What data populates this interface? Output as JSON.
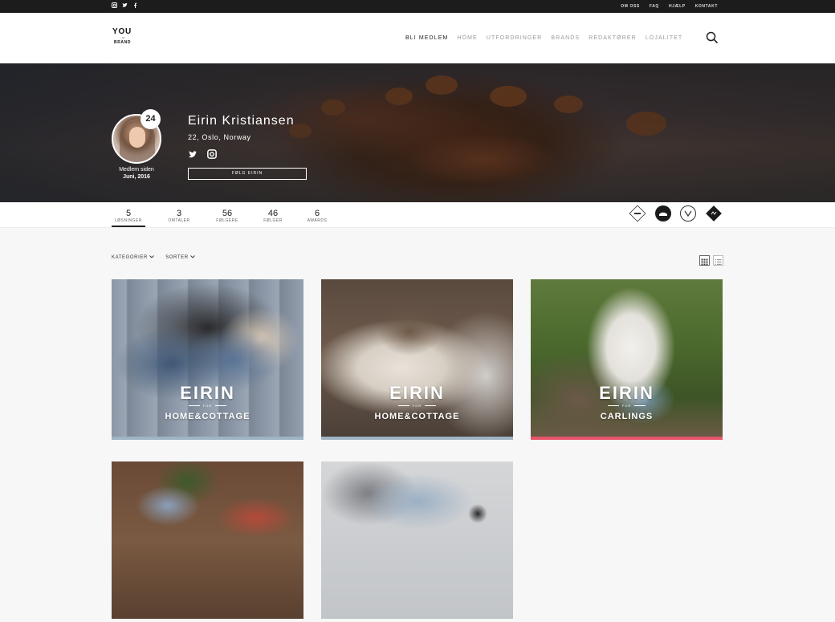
{
  "topbar": {
    "social_icons": [
      "instagram-icon",
      "twitter-icon",
      "facebook-icon"
    ],
    "links": [
      "OM OSS",
      "FAQ",
      "HJÆLP",
      "KONTAKT"
    ]
  },
  "header": {
    "logo": {
      "line1": "YOU",
      "line2": "for",
      "line3": "BRAND"
    },
    "nav": [
      "BLI MEDLEM",
      "HOME",
      "UTFORDRINGER",
      "BRANDS",
      "REDAKTØRER",
      "LOJALITET"
    ],
    "search_icon": "search-icon"
  },
  "profile": {
    "level": "24",
    "name": "Eirin Kristiansen",
    "location": "22, Oslo, Norway",
    "member_since_label": "Medlem siden",
    "member_since_date": "Juni, 2016",
    "social_icons": [
      "twitter-icon",
      "instagram-icon"
    ],
    "follow_label": "FØLG EIRIN"
  },
  "stats": [
    {
      "value": "5",
      "label": "LØSNINGER",
      "active": true
    },
    {
      "value": "3",
      "label": "OMTALER",
      "active": false
    },
    {
      "value": "56",
      "label": "FØLGERE",
      "active": false
    },
    {
      "value": "46",
      "label": "FØLGER",
      "active": false
    },
    {
      "value": "6",
      "label": "AWARDS",
      "active": false
    }
  ],
  "brand_badges": [
    "brand-badge-1",
    "brand-badge-2",
    "brand-badge-3",
    "brand-badge-4"
  ],
  "filters": {
    "category": "KATEGORIER",
    "sort": "SORTER"
  },
  "view_toggle": [
    "grid-view-icon",
    "list-view-icon"
  ],
  "cards": [
    {
      "title": "EIRIN",
      "for": "FOR",
      "brand": "HOME&COTTAGE",
      "accent": "#9fb4c4"
    },
    {
      "title": "EIRIN",
      "for": "FOR",
      "brand": "HOME&COTTAGE",
      "accent": "#9fb4c4"
    },
    {
      "title": "EIRIN",
      "for": "FOR",
      "brand": "CARLINGS",
      "accent": "#e8546b"
    },
    {
      "title": "",
      "for": "",
      "brand": "",
      "accent": ""
    },
    {
      "title": "",
      "for": "",
      "brand": "",
      "accent": ""
    }
  ]
}
